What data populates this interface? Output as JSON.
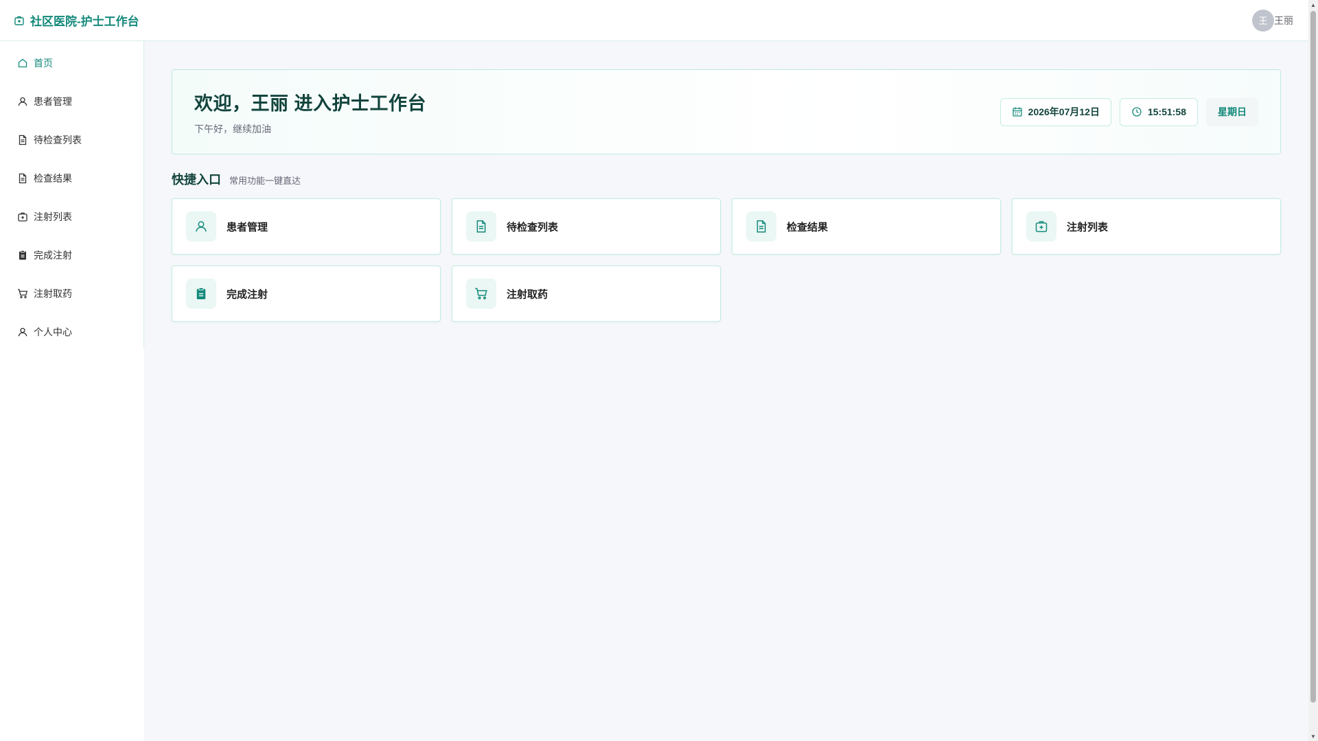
{
  "header": {
    "title": "社区医院-护士工作台",
    "brand_icon": "medical-kit-icon",
    "user": {
      "avatar_text": "王",
      "name": "王丽"
    }
  },
  "sidebar": {
    "items": [
      {
        "label": "首页",
        "icon": "home-icon",
        "active": true
      },
      {
        "label": "患者管理",
        "icon": "user-icon"
      },
      {
        "label": "待检查列表",
        "icon": "document-icon"
      },
      {
        "label": "检查结果",
        "icon": "document-icon"
      },
      {
        "label": "注射列表",
        "icon": "medical-kit-icon"
      },
      {
        "label": "完成注射",
        "icon": "clipboard-icon"
      },
      {
        "label": "注射取药",
        "icon": "cart-icon"
      },
      {
        "label": "个人中心",
        "icon": "user-icon"
      }
    ]
  },
  "welcome": {
    "title": "欢迎，王丽 进入护士工作台",
    "subtitle": "下午好，继续加油",
    "date": "2026年07月12日",
    "time": "15:51:58",
    "weekday": "星期日"
  },
  "quick": {
    "title": "快捷入口",
    "subtitle": "常用功能一键直达",
    "cards": [
      {
        "label": "患者管理",
        "icon": "user-icon"
      },
      {
        "label": "待检查列表",
        "icon": "document-icon"
      },
      {
        "label": "检查结果",
        "icon": "document-icon"
      },
      {
        "label": "注射列表",
        "icon": "medical-kit-icon"
      },
      {
        "label": "完成注射",
        "icon": "clipboard-icon"
      },
      {
        "label": "注射取药",
        "icon": "cart-icon"
      }
    ]
  },
  "colors": {
    "accent": "#13897a",
    "heading": "#12443d",
    "border": "#c3ebe2",
    "background": "#f5f7fa"
  }
}
